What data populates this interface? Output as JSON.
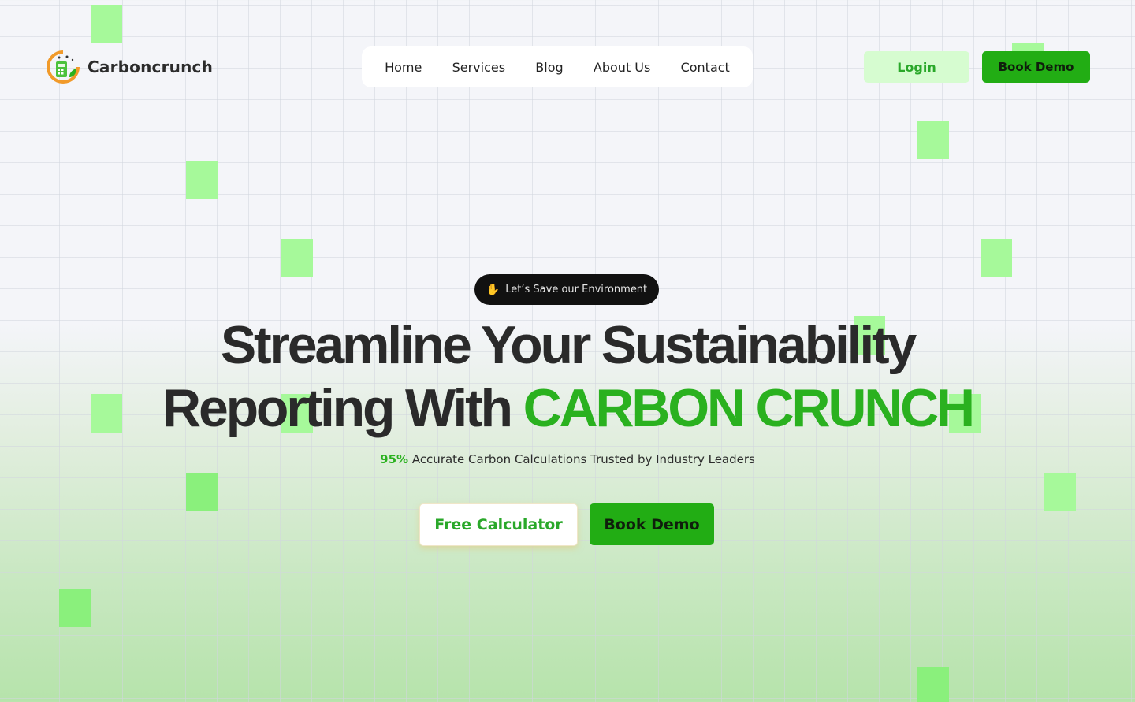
{
  "brand": {
    "name": "Carboncrunch",
    "logo_icon": "calculator-leaf-logo"
  },
  "nav": {
    "items": [
      {
        "label": "Home"
      },
      {
        "label": "Services"
      },
      {
        "label": "Blog"
      },
      {
        "label": "About Us"
      },
      {
        "label": "Contact"
      }
    ]
  },
  "header": {
    "login_label": "Login",
    "book_demo_label": "Book Demo"
  },
  "hero": {
    "badge_icon": "waving-hand-icon",
    "badge_text": "Let’s Save our Environment",
    "headline_line1": "Streamline Your Sustainability",
    "headline_line2_prefix": "Reporting With ",
    "headline_line2_accent": "CARBON CRUNCH",
    "subtitle_highlight": "95%",
    "subtitle_rest": " Accurate Carbon Calculations Trusted by Industry Leaders",
    "cta_calculator": "Free Calculator",
    "cta_book_demo": "Book Demo"
  },
  "colors": {
    "accent_green": "#2ab11f",
    "button_green": "#22ad14",
    "login_bg": "#d6fcd0",
    "square_green": "#a6f99a",
    "badge_bg": "#111111"
  }
}
